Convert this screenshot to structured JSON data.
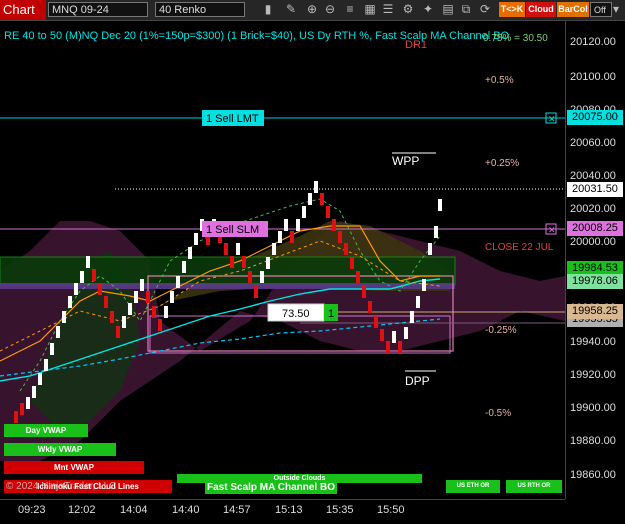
{
  "toolbar": {
    "app_label": "Chart",
    "instrument": "MNQ 09-24",
    "bar_type": "40 Renko",
    "tk_label": "T<>K",
    "cloud_label": "Cloud",
    "barcol_label": "BarCol",
    "toggle_label": "Off"
  },
  "header": {
    "info": "RE 40 to 50 (M)NQ Dec 20 (1%=150p=$300) (1 Brick=$40), US Dy RTH %, Fast Scalp MA Channel BO",
    "info_right": "0.75% = 30.50"
  },
  "levels": {
    "dr1": "DR1",
    "plus05": "+0.5%",
    "plus025": "+0.25%",
    "wpp": "WPP",
    "close22": "CLOSE 22 JUL",
    "minus025": "-0.25%",
    "dpp": "DPP",
    "minus05": "-0.5%"
  },
  "orders": {
    "sell_lmt": "1 Sell LMT",
    "sell_slm": "1 Sell SLM",
    "box_value": "73.50",
    "box_qty": "1"
  },
  "buttons": {
    "day_vwap": "Day VWAP",
    "wkly_vwap": "Wkly VWAP",
    "mnt_vwap": "Mnt VWAP",
    "ichimoku": "Ichimoku Fast Cloud Lines",
    "outside_clouds": "Outside Clouds",
    "fast_scalp": "Fast Scalp MA Channel BO",
    "us_eth": "US ETH OR",
    "us_rth": "US RTH OR"
  },
  "copyright": "© 2024 NinjaTrader, LLC",
  "price_axis": [
    "20120.00",
    "20100.00",
    "20080.00",
    "20060.00",
    "20040.00",
    "20020.00",
    "20000.00",
    "19980.00",
    "19960.00",
    "19940.00",
    "19920.00",
    "19900.00",
    "19880.00",
    "19860.00"
  ],
  "price_tags": {
    "sell_lmt": "20075.00",
    "last": "20031.50",
    "sell_slm": "20008.25",
    "green1": "19984.53",
    "cyan": "19978.06",
    "tan": "19958.25",
    "gray": "19955.35"
  },
  "time_axis": [
    "09:23",
    "12:02",
    "14:04",
    "14:40",
    "14:57",
    "15:13",
    "15:35",
    "15:50"
  ],
  "colors": {
    "up_brick": "#ffffff",
    "down_brick": "#e01010",
    "cyan": "#00e5e5",
    "orange": "#ff9900",
    "green": "#19c019",
    "magenta": "#d070d0",
    "red_btn": "#d00000"
  }
}
